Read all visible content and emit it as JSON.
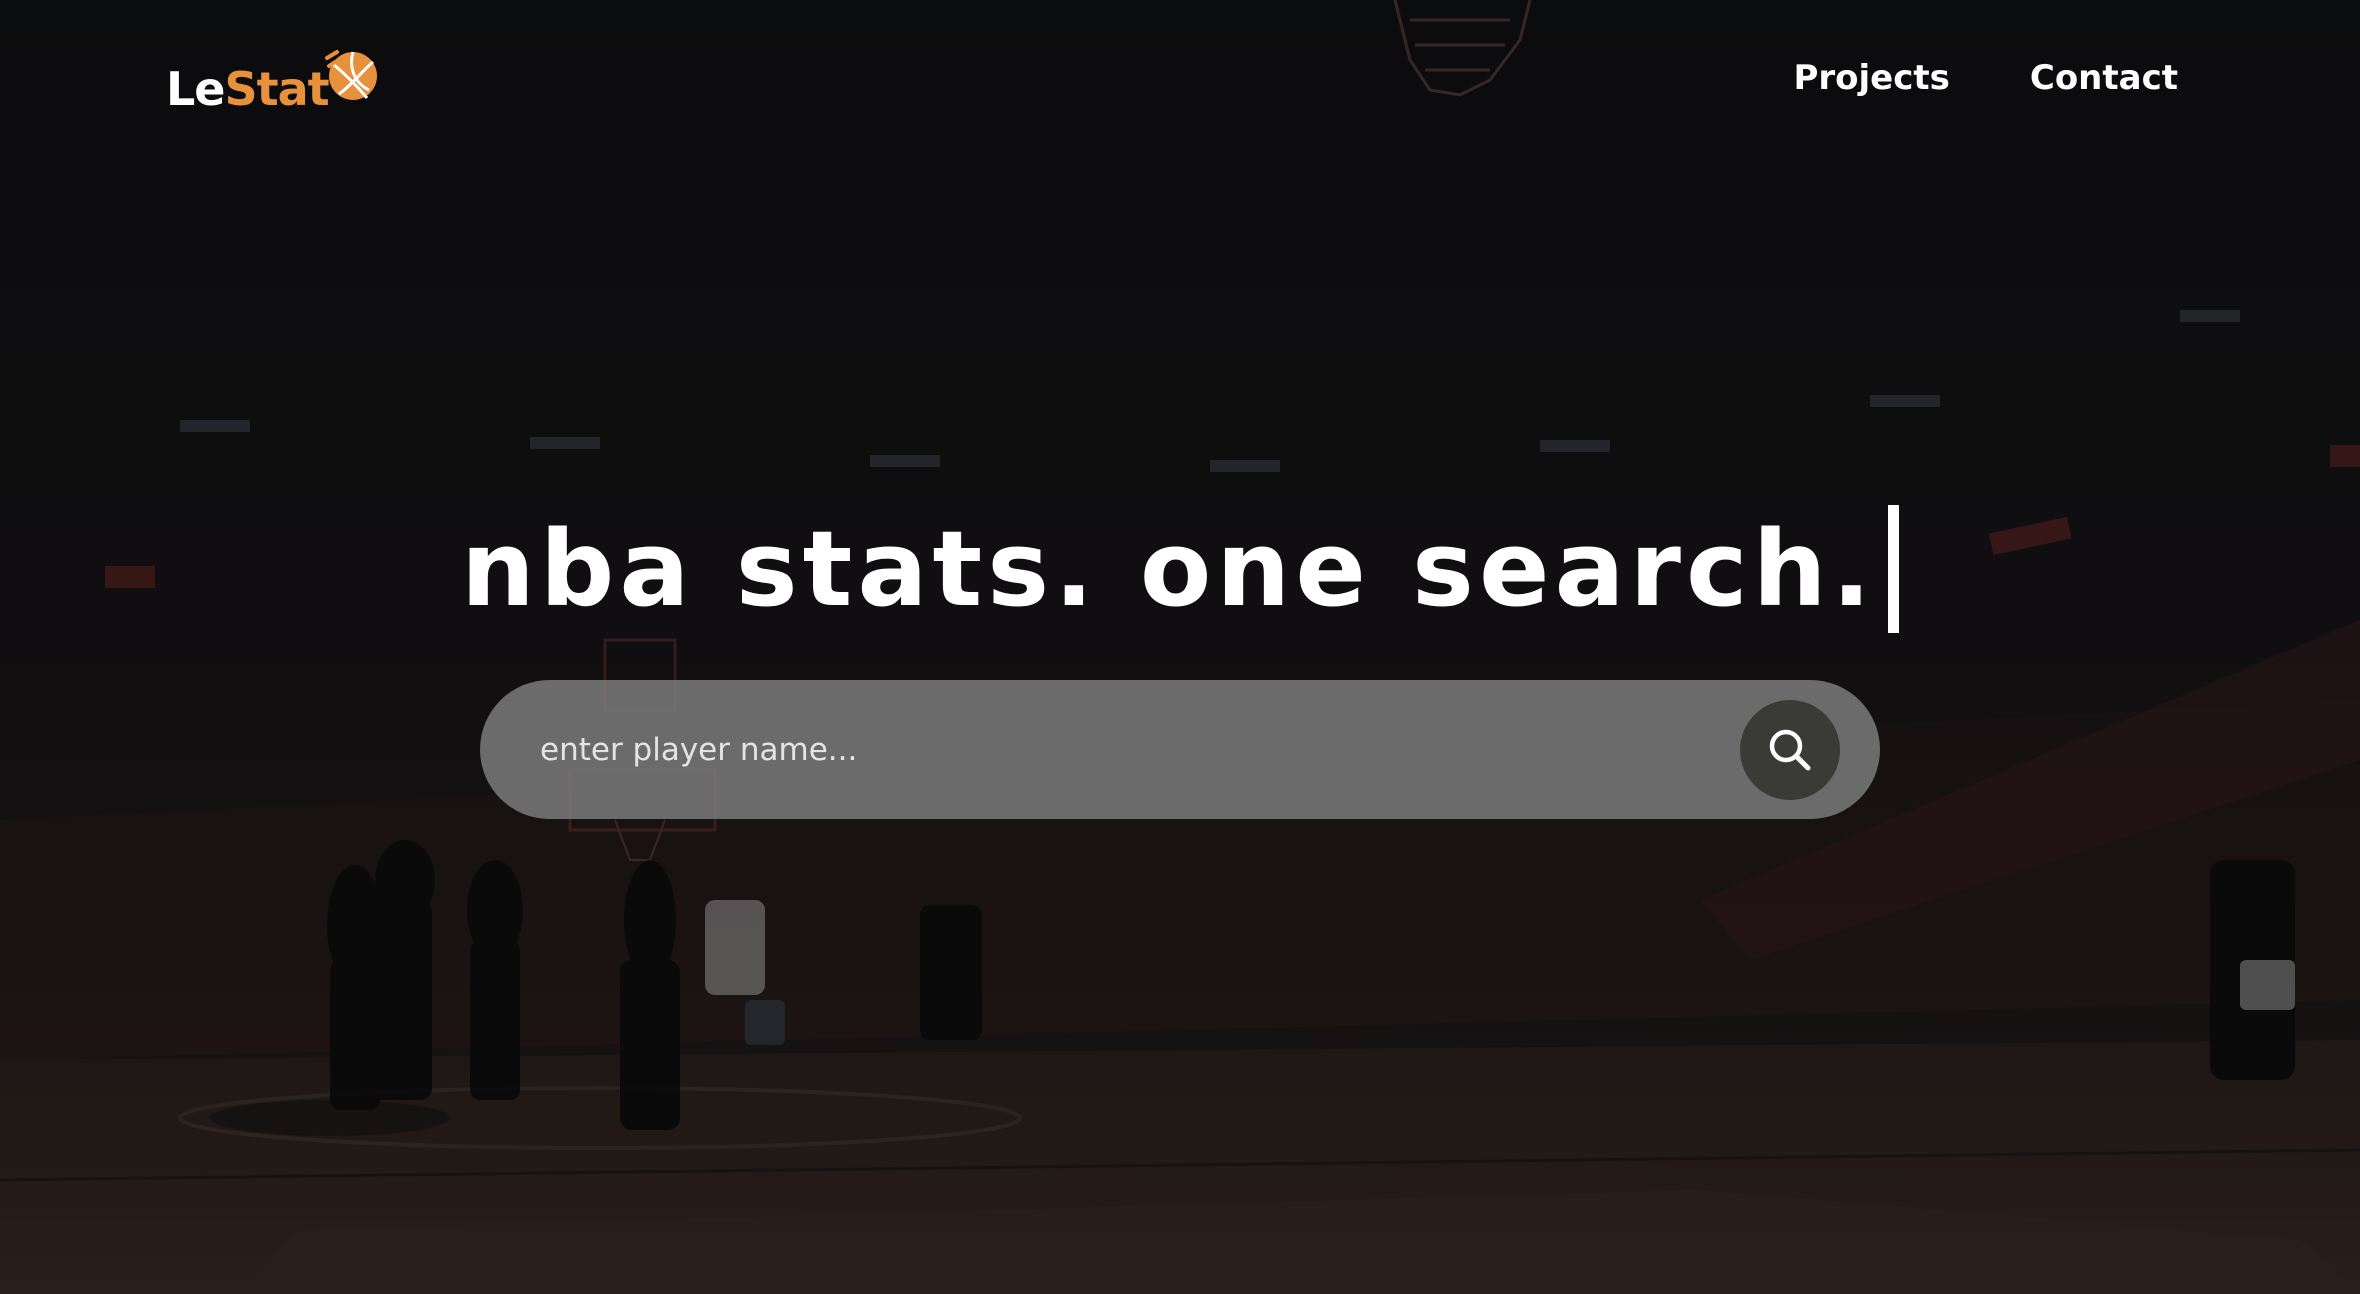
{
  "brand": {
    "name_part1": "Le",
    "name_part2": "Stat",
    "logo_icon": "basketball-icon",
    "accent_color": "#e7913c"
  },
  "nav": {
    "links": [
      {
        "label": "Projects"
      },
      {
        "label": "Contact"
      }
    ]
  },
  "hero": {
    "headline": "nba stats. one search."
  },
  "search": {
    "placeholder": "enter player name...",
    "value": "",
    "button_icon": "search-icon"
  },
  "background": {
    "description_icon": "basketball-court-photo",
    "overlay_color": "#141414"
  }
}
